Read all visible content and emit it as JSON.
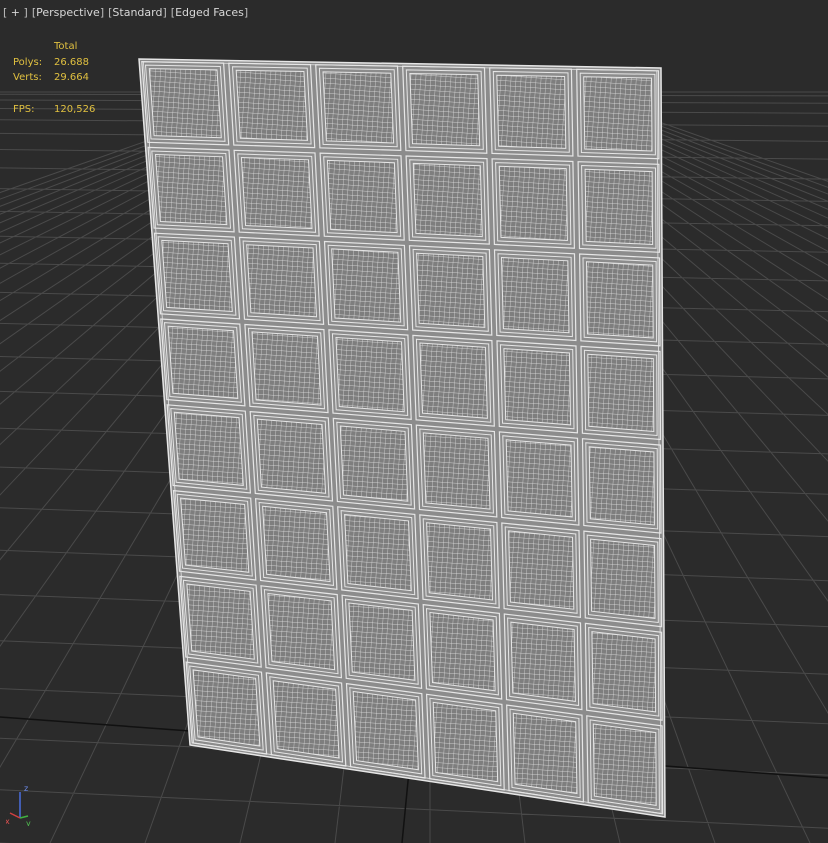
{
  "viewport": {
    "menu": {
      "plus": "+",
      "view": "Perspective",
      "shading": "Standard",
      "edges": "Edged Faces"
    },
    "stats": {
      "header": "Total",
      "polys_label": "Polys:",
      "polys_value": "26.688",
      "verts_label": "Verts:",
      "verts_value": "29.664",
      "fps_label": "FPS:",
      "fps_value": "120,526"
    },
    "axis_gizmo": {
      "x": "x",
      "y": "y",
      "z": "z"
    },
    "colors": {
      "background": "#2b2b2b",
      "grid": "#4a4a4a",
      "stats_text": "#e0c040",
      "wire": "#e6e6e6",
      "border": "#8a6d1c"
    },
    "model": {
      "rows": 8,
      "columns": 6
    }
  }
}
